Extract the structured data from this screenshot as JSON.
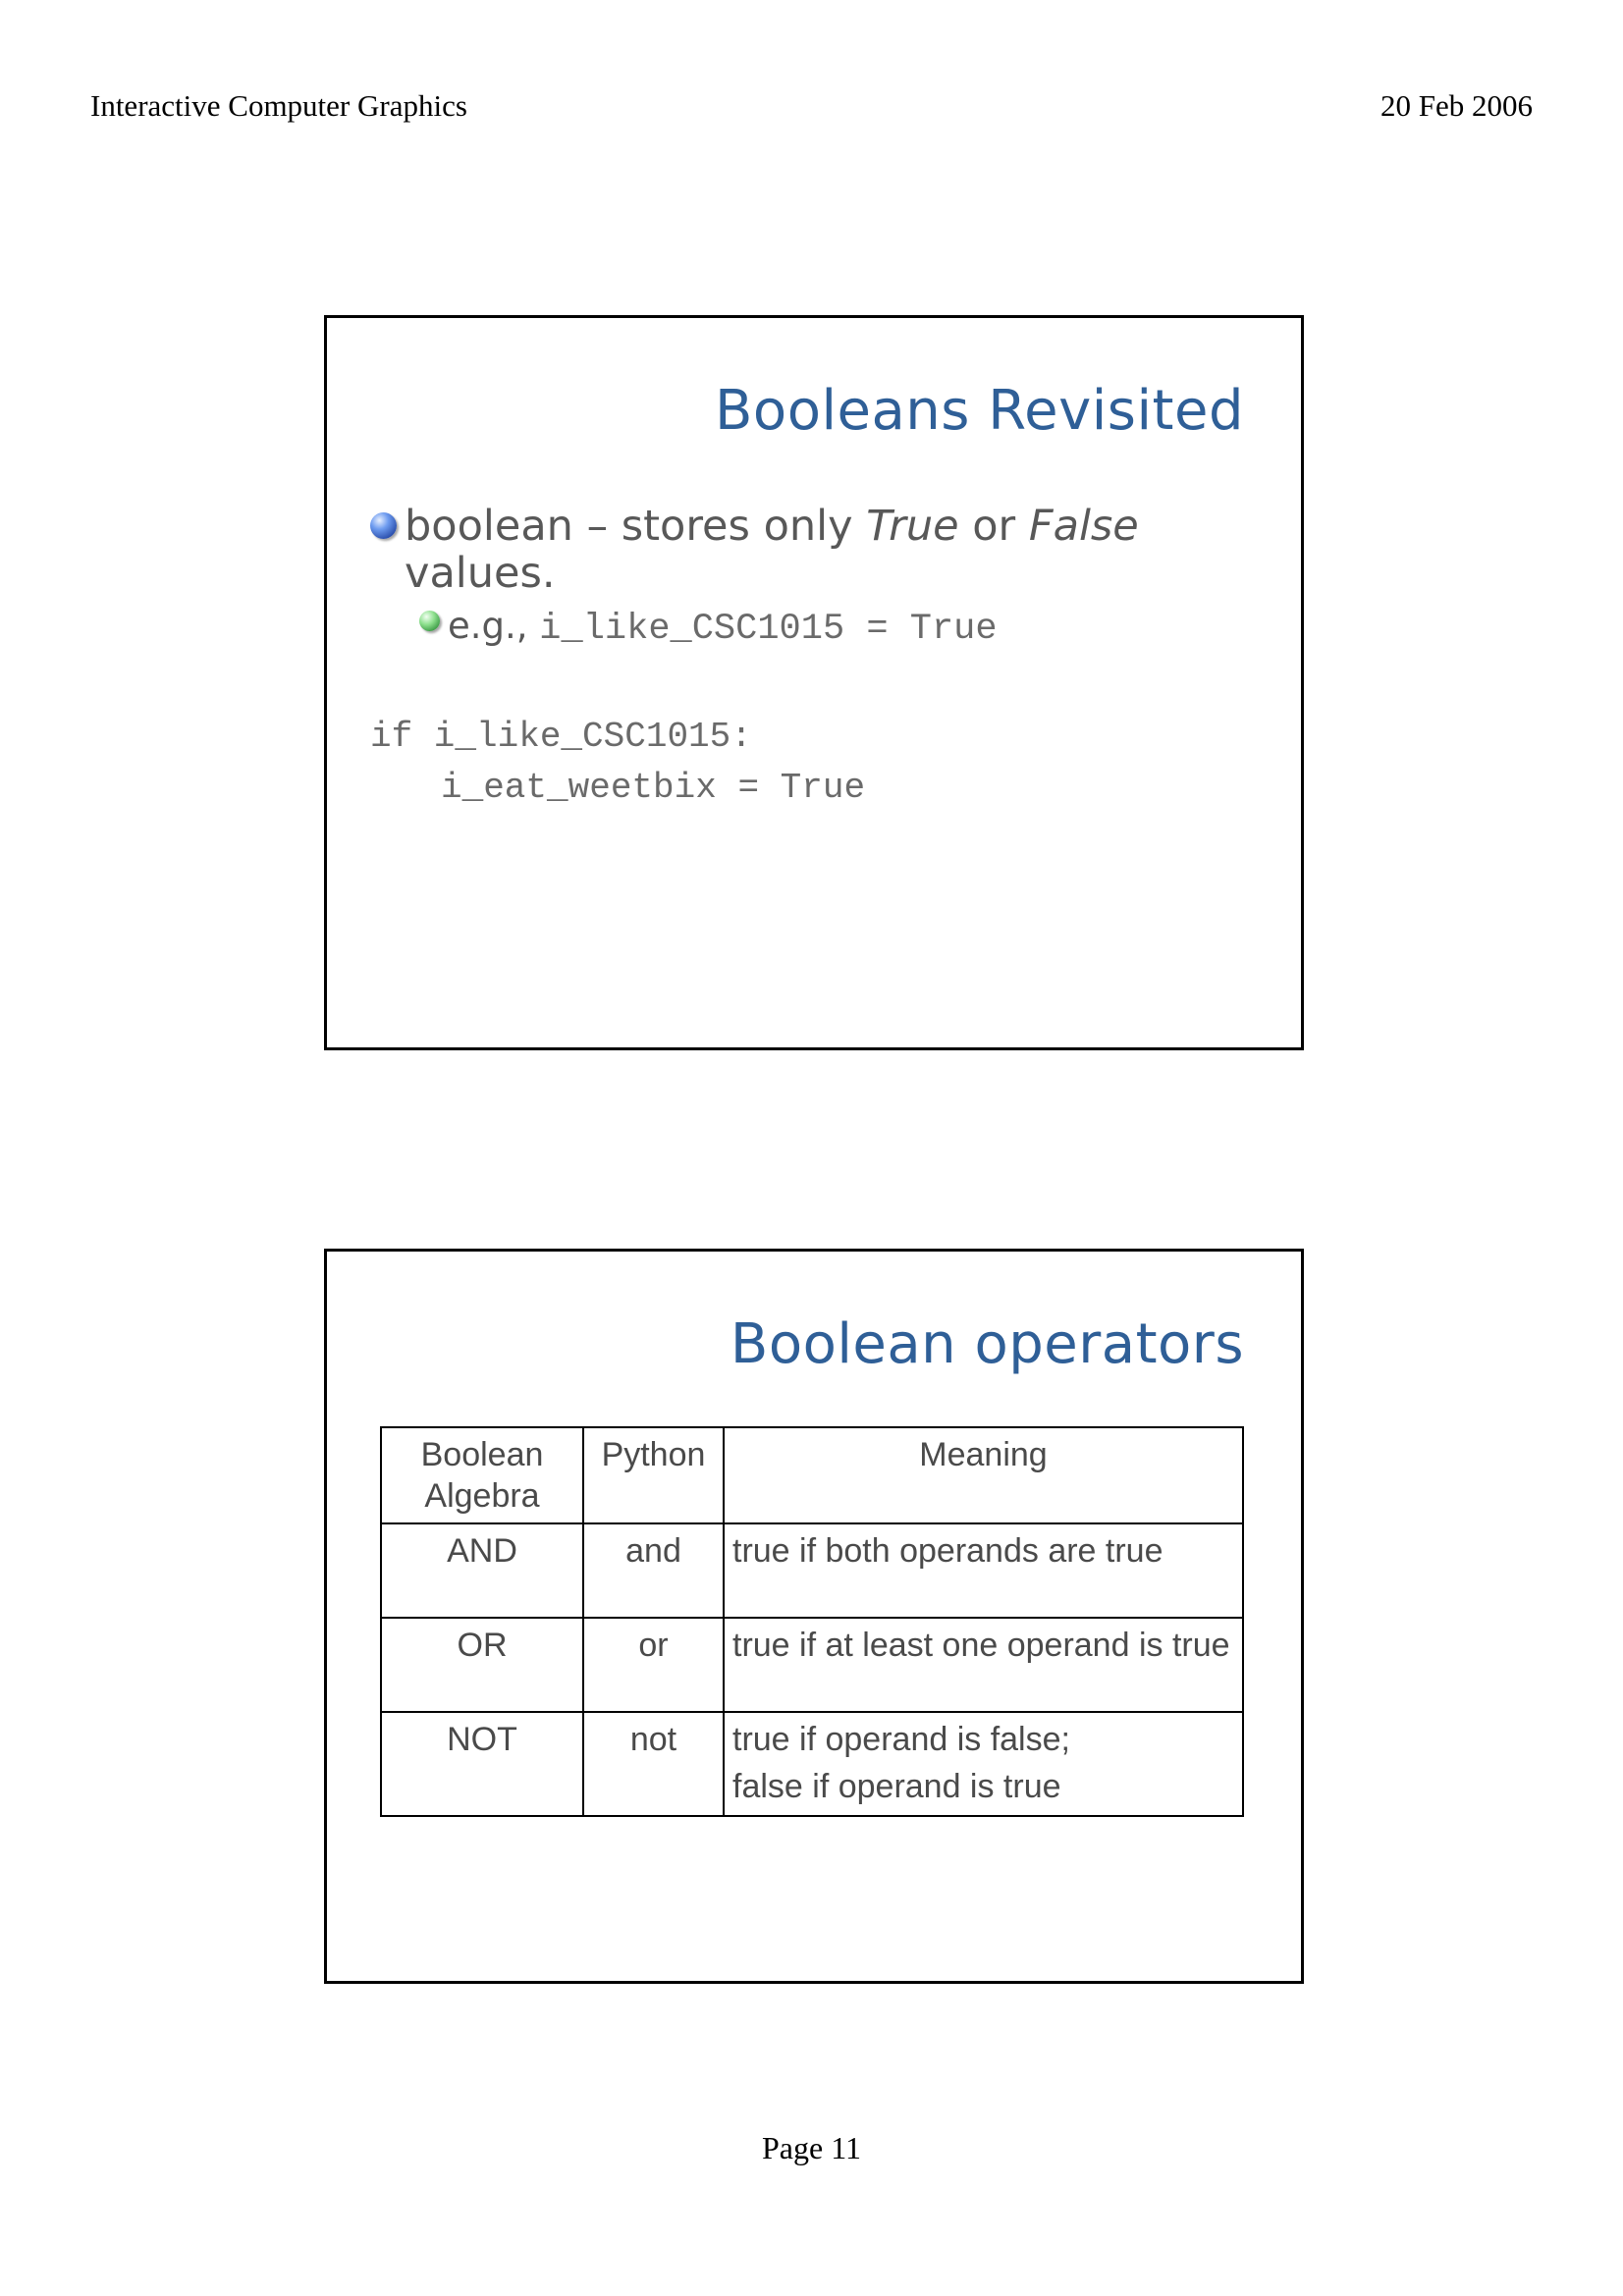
{
  "header": {
    "left": "Interactive Computer Graphics",
    "right": "20 Feb 2006"
  },
  "slide1": {
    "title": "Booleans Revisited",
    "bullet1": {
      "pre": "boolean – stores only ",
      "em1": "True",
      "mid": " or ",
      "em2": "False",
      "post": " values."
    },
    "bullet2": {
      "text": "e.g., ",
      "code": "i_like_CSC1015 = True"
    },
    "code_line1": "if i_like_CSC1015:",
    "code_line2": "i_eat_weetbix = True"
  },
  "slide2": {
    "title": "Boolean operators",
    "table": {
      "headers": [
        "Boolean Algebra",
        "Python",
        "Meaning"
      ],
      "rows": [
        {
          "algebra": "AND",
          "python": "and",
          "meaning": "true if both operands are true"
        },
        {
          "algebra": "OR",
          "python": "or",
          "meaning": "true if at least one operand is true"
        },
        {
          "algebra": "NOT",
          "python": "not",
          "meaning": "true if operand is false;",
          "meaning2": "false if operand is true"
        }
      ]
    }
  },
  "footer": {
    "page": "Page 11"
  },
  "colors": {
    "title_blue": "#2f5f97",
    "body_gray": "#585858"
  }
}
